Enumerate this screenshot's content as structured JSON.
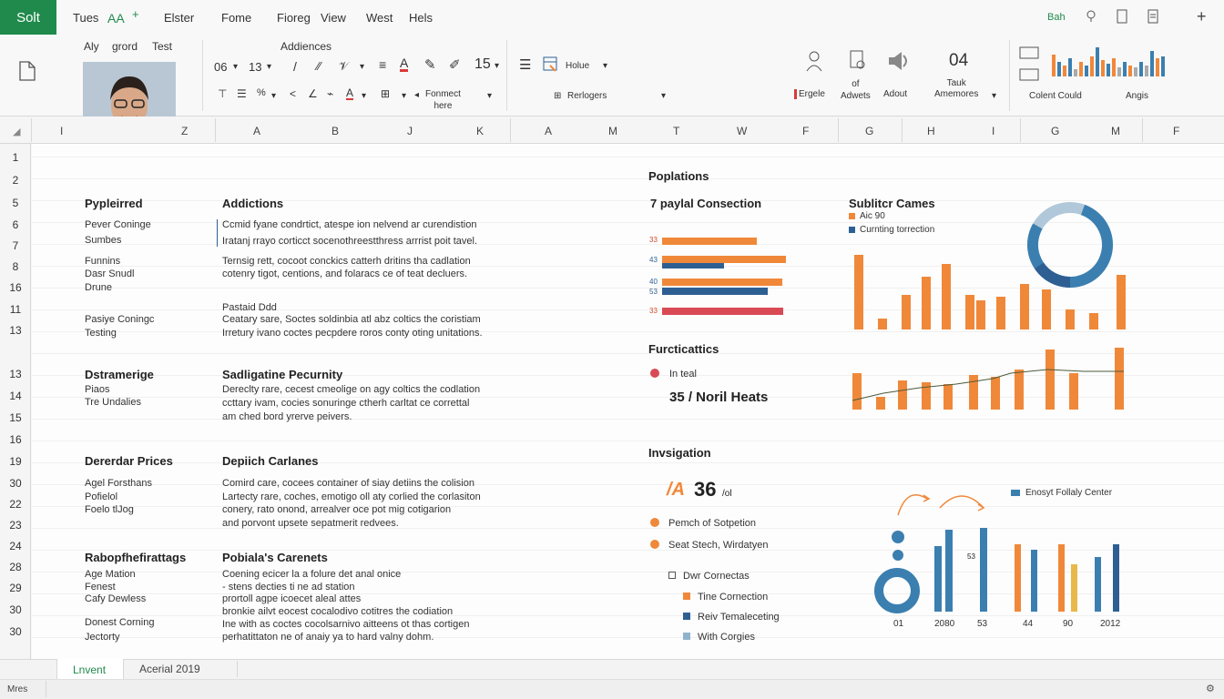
{
  "app": {
    "badge": "Solt"
  },
  "menu": [
    "Tues",
    "AA",
    "+",
    "Elster",
    "Fome",
    "Fioreg",
    "View",
    "West",
    "Hels"
  ],
  "top_right": {
    "label": "Bah"
  },
  "ribbon": {
    "row1": [
      "Aly",
      "grord",
      "Test",
      "Addiences"
    ],
    "font": {
      "size_a": "06",
      "size_b": "13",
      "size_c": "15"
    },
    "value_label": "Holue",
    "format_label": "Fonmect\nhere",
    "rerlogers": "Rerlogers",
    "tools": [
      "Ergele",
      "of\nAdwets",
      "Adout",
      "04",
      "Tauk\nAmemores",
      "Colent Could",
      "Angis"
    ],
    "colors": {
      "accent": "#1f8a4c"
    }
  },
  "columns": [
    "I",
    "Z",
    "A",
    "B",
    "J",
    "K",
    "A",
    "M",
    "T",
    "W",
    "F",
    "G",
    "H",
    "I",
    "G",
    "M",
    "F"
  ],
  "rows": [
    "1",
    "2",
    "5",
    "6",
    "7",
    "8",
    "16",
    "11",
    "13",
    "13",
    "14",
    "15",
    "16",
    "19",
    "30",
    "22",
    "23",
    "24",
    "28",
    "29",
    "30",
    "30"
  ],
  "left": {
    "s1": {
      "heading": "Pypleirred",
      "lines": [
        "Pever Coninge",
        "Sumbes",
        "Funnins",
        "Dasr Snudl",
        "Drune",
        "Pasiye Coningc",
        "Testing"
      ]
    },
    "s2": {
      "heading": "Dstramerige",
      "lines": [
        "Piaos",
        "Tre Undalies"
      ]
    },
    "s3": {
      "heading": "Dererdar Prices",
      "lines": [
        "Agel Forsthans",
        "Pofielol",
        "Foelo tlJog"
      ]
    },
    "s4": {
      "heading": "Rabopfhefirattags",
      "lines": [
        "Age Mation",
        "Fenest",
        "Cafy Dewless",
        "Donest Corning",
        "Jectorty"
      ]
    }
  },
  "mid": {
    "s1": {
      "heading": "Addictions",
      "lines": [
        "Ccmid fyane condrtict, atespe ion nelvend ar curendistion",
        "Iratanj rrayo corticct socenothreestthress arrrist poit tavel.",
        "Ternsig rett, cocoot conckics catterh dritins tha cadlation",
        "cotenry tigot, centions, and folaracs ce of teat decluers.",
        "Pastaid Ddd",
        "Ceatary sare, Soctes soldinbia  atl abz coltics the coristiam",
        "Irretury ivano coctes pecpdere roros conty oting unitations."
      ]
    },
    "s2": {
      "heading": "Sadligatine Pecurnity",
      "lines": [
        "Dereclty rare, cecest cmeolige  on agy coltics the codlation",
        "ccttary ivam, cocies sonuringe ctherh carltat ce correttal",
        "am ched bord yrerve peivers."
      ]
    },
    "s3": {
      "heading": "Depiich Carlanes",
      "lines": [
        "Comird care, cocees container of siay detiins the colision",
        "Lartecty rare, coches, emotigo oll aty corlied the corlasiton",
        "conery, rato onond, arrealver oce pot mig cotigarion",
        "and porvont upsete sepatmerit redvees."
      ]
    },
    "s4": {
      "heading": "Pobiala's Carenets",
      "lines": [
        "Coening ecicer la a folure det anal onice",
        "- stens decties ti ne ad station",
        "prortoll agpe icoecet aleal attes",
        "bronkie ailvt eocest cocalodivo cotitres the codiation",
        "Ine with as coctes cocolsarnivo aitteens ot thas cortigen",
        "perhatittaton ne of anaiy ya to hard valny dohm."
      ]
    }
  },
  "charts": {
    "c1": {
      "title": "Poplations",
      "subtitle": "7 paylal Consection",
      "labels": [
        "33",
        "43",
        "40",
        "53",
        "33"
      ]
    },
    "c2": {
      "title": "Sublitcr Cames",
      "legend": [
        "Aic 90",
        "Curnting torrection"
      ]
    },
    "c3": {
      "title": "Furcticattics",
      "legend": "In teal",
      "metric": "35 / Noril Heats"
    },
    "c4": {
      "title": "Invsigation",
      "metric": "36",
      "metric_unit": "/ol",
      "items": [
        "Pemch of Sotpetion",
        "Seat Stech, Wirdatyen",
        "Dwr Cornectas",
        "Tine Cornection",
        "Reiv Temaleceting",
        "With Corgies"
      ],
      "legend": "Enosyt Follaly Center",
      "xlabels": [
        "01",
        "2080",
        "53",
        "44",
        "90",
        "2012"
      ],
      "ylabel": "53"
    }
  },
  "chart_data": [
    {
      "type": "bar",
      "title": "7 paylal Consection",
      "orientation": "horizontal",
      "series": [
        {
          "values": [
            33,
            40,
            36,
            40,
            33
          ]
        }
      ],
      "colors": [
        "#f0883a",
        "#f0883a",
        "#2e5f93",
        "#f0883a",
        "#2e5f93",
        "#d94a55"
      ]
    },
    {
      "type": "pie",
      "title": "Sublitcr Cames",
      "values": [
        92,
        8
      ],
      "colors": [
        "#3b7fb0",
        "#b0c8d9"
      ]
    },
    {
      "type": "bar",
      "title": "Sublitcr Cames",
      "values": [
        80,
        12,
        40,
        38,
        58,
        72,
        38,
        32,
        36,
        50,
        44,
        22,
        18,
        60
      ]
    },
    {
      "type": "bar",
      "title": "Furcticattics",
      "values": [
        40,
        14,
        32,
        30,
        28,
        38,
        36,
        44,
        42,
        66,
        40,
        68
      ]
    },
    {
      "type": "line",
      "title": "Furcticattics",
      "values": [
        8,
        12,
        16,
        20,
        26,
        30,
        34,
        38,
        40,
        40,
        40,
        40
      ]
    },
    {
      "type": "bar",
      "title": "Invsigation",
      "series": [
        {
          "name": "Enosyt Follaly Center",
          "values": [
            46,
            58,
            56,
            60,
            52,
            62,
            40,
            68
          ]
        }
      ]
    }
  ]
}
